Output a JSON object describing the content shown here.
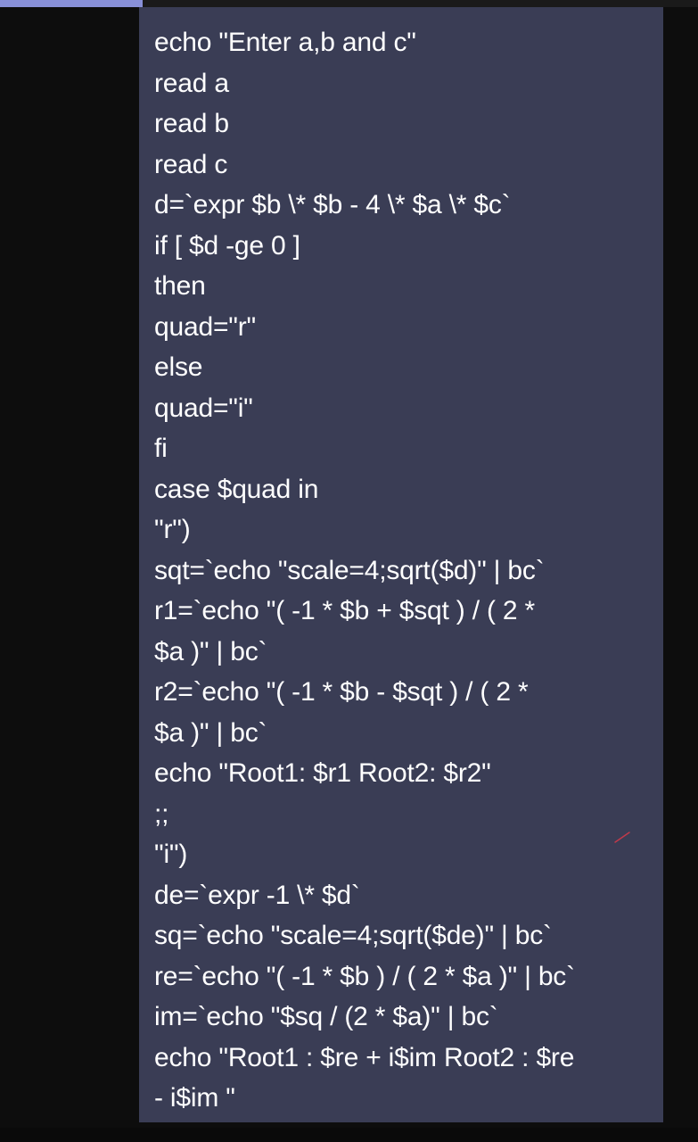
{
  "code": {
    "lines": [
      "echo \"Enter a,b and c\"",
      "read a",
      "read b",
      "read c",
      "d=`expr $b \\* $b - 4 \\* $a \\* $c`",
      "if [ $d -ge 0 ]",
      "then",
      "quad=\"r\"",
      "else",
      "quad=\"i\"",
      "fi",
      "case $quad in",
      "\"r\")",
      "sqt=`echo \"scale=4;sqrt($d)\" | bc`",
      "r1=`echo \"( -1 * $b + $sqt ) / ( 2 *",
      "$a )\" | bc`",
      "r2=`echo \"( -1 * $b - $sqt ) / ( 2 *",
      "$a )\" | bc`",
      "echo \"Root1: $r1 Root2: $r2\"",
      ";;",
      "\"i\")",
      "de=`expr -1 \\* $d`",
      "sq=`echo \"scale=4;sqrt($de)\" | bc`",
      "re=`echo \"( -1 * $b ) / ( 2 * $a )\" | bc`",
      "im=`echo \"$sq / (2 * $a)\" | bc`",
      "echo \"Root1 : $re + i$im Root2 : $re",
      "- i$im \""
    ]
  },
  "colors": {
    "panel_background": "#3a3d55",
    "page_background": "#0d0d0d",
    "text": "#ffffff",
    "top_accent": "#8890d8"
  }
}
